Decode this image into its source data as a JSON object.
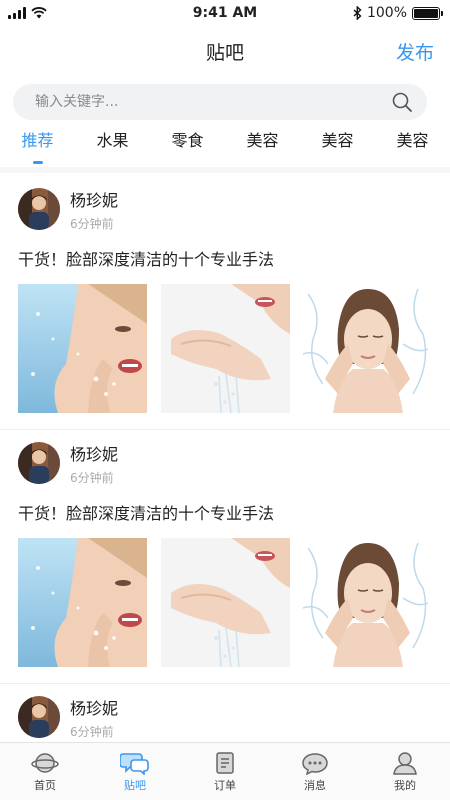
{
  "status_bar": {
    "time": "9:41 AM",
    "battery_text": "100%",
    "battery_level": 1.0
  },
  "nav": {
    "title": "贴吧",
    "publish_label": "发布"
  },
  "search": {
    "placeholder": "输入关键字..."
  },
  "tabs": [
    {
      "label": "推荐",
      "active": true
    },
    {
      "label": "水果",
      "active": false
    },
    {
      "label": "零食",
      "active": false
    },
    {
      "label": "美容",
      "active": false
    },
    {
      "label": "美容",
      "active": false
    },
    {
      "label": "美容",
      "active": false
    }
  ],
  "posts": [
    {
      "author": "杨珍妮",
      "time": "6分钟前",
      "title": "干货！脸部深度清洁的十个专业手法"
    },
    {
      "author": "杨珍妮",
      "time": "6分钟前",
      "title": "干货！脸部深度清洁的十个专业手法"
    },
    {
      "author": "杨珍妮",
      "time": "6分钟前"
    }
  ],
  "tab_bar": [
    {
      "label": "首页",
      "icon": "planet-icon",
      "active": false
    },
    {
      "label": "贴吧",
      "icon": "chat-bubbles-icon",
      "active": true
    },
    {
      "label": "订单",
      "icon": "document-icon",
      "active": false
    },
    {
      "label": "消息",
      "icon": "message-icon",
      "active": false
    },
    {
      "label": "我的",
      "icon": "person-icon",
      "active": false
    }
  ],
  "colors": {
    "accent": "#3a97f0",
    "text": "#222222",
    "muted": "#aaaaaa",
    "search_bg": "#f1f2f4"
  }
}
